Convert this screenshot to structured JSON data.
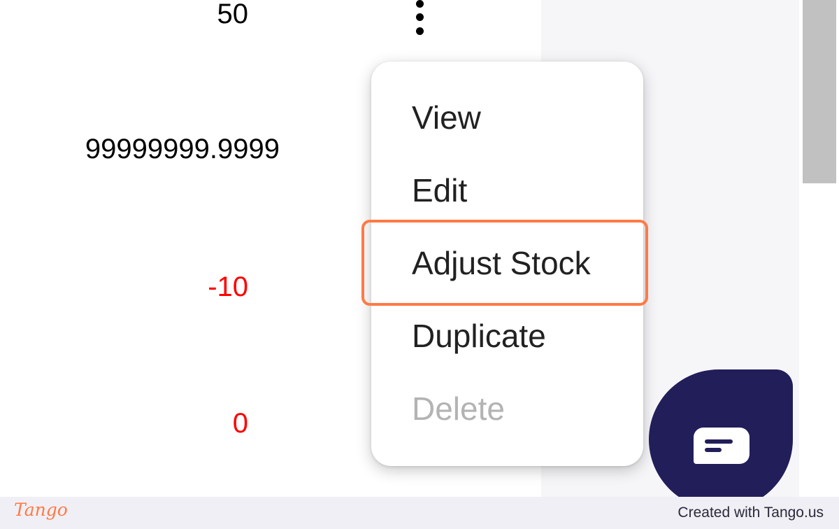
{
  "table": {
    "values": [
      {
        "text": "50",
        "negative": false
      },
      {
        "text": "99999999.9999",
        "negative": false
      },
      {
        "text": "-10",
        "negative": true
      },
      {
        "text": "0",
        "negative": true
      }
    ]
  },
  "row_actions": {
    "icon": "kebab-menu-icon"
  },
  "context_menu": {
    "items": [
      {
        "label": "View",
        "enabled": true
      },
      {
        "label": "Edit",
        "enabled": true
      },
      {
        "label": "Adjust Stock",
        "enabled": true,
        "highlighted": true
      },
      {
        "label": "Duplicate",
        "enabled": true
      },
      {
        "label": "Delete",
        "enabled": false
      }
    ]
  },
  "chat": {
    "icon": "chat-bubble-icon",
    "color": "#221e5a"
  },
  "footer": {
    "logo": "Tango",
    "credit": "Created with Tango.us",
    "accent": "#ff7a45"
  }
}
